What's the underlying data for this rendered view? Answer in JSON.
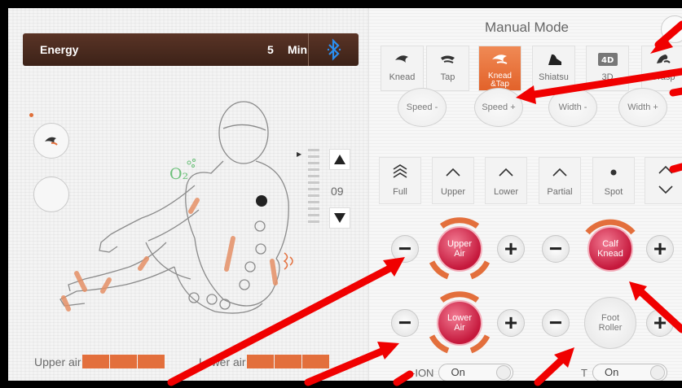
{
  "energy": {
    "label": "Energy",
    "value": "5",
    "unit": "Min"
  },
  "o2": {
    "label": "O₂"
  },
  "level": {
    "value": "09"
  },
  "air_status": {
    "upper_label": "Upper air",
    "lower_label": "Lower air"
  },
  "manual_mode": {
    "title": "Manual Mode",
    "techniques": [
      {
        "label": "Knead",
        "active": false
      },
      {
        "label": "Tap",
        "active": false
      },
      {
        "label": "Knead\n&Tap",
        "active": true
      },
      {
        "label": "Shiatsu",
        "active": false
      },
      {
        "label": "3D",
        "active": false
      },
      {
        "label": "Grasp",
        "active": false
      }
    ],
    "speed_width": [
      "Speed -",
      "Speed +",
      "Width -",
      "Width +"
    ],
    "positions": [
      "Full",
      "Upper",
      "Lower",
      "Partial",
      "Spot"
    ],
    "controls": {
      "upper_air": "Upper\nAir",
      "lower_air": "Lower\nAir",
      "calf_knead": "Calf\nKnead",
      "foot_roller": "Foot\nRoller",
      "minus": "−",
      "plus": "+"
    },
    "ion": {
      "label": "-ION",
      "state": "On"
    },
    "heat": {
      "label": "T",
      "state": "On"
    }
  },
  "colors": {
    "accent": "#e36f3c",
    "energy_bar": "#4a2b1f",
    "air_red": "#c5183c",
    "bluetooth": "#2a8ef0",
    "arrow": "#f00000"
  }
}
